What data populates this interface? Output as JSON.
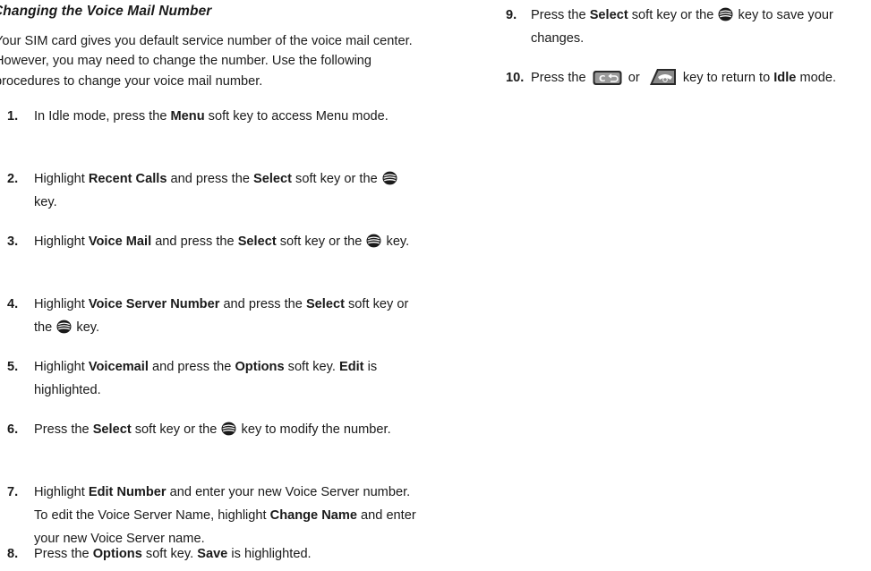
{
  "heading": "Changing the Voice Mail Number",
  "intro": "Your SIM card gives you default service number of the voice mail center. However, you may need to change the number. Use the following procedures to change your voice mail number.",
  "steps": [
    {
      "num": "1.",
      "segments": [
        {
          "t": "In Idle mode, press the "
        },
        {
          "t": "Menu",
          "b": true
        },
        {
          "t": " soft key to access Menu mode."
        }
      ]
    },
    {
      "num": "2.",
      "segments": [
        {
          "t": "Highlight "
        },
        {
          "t": "Recent Calls",
          "b": true
        },
        {
          "t": " and press the "
        },
        {
          "t": "Select",
          "b": true
        },
        {
          "t": " soft key or the "
        },
        {
          "icon": "ok-key-icon"
        },
        {
          "t": " key."
        }
      ]
    },
    {
      "num": "3.",
      "segments": [
        {
          "t": "Highlight "
        },
        {
          "t": "Voice Mail",
          "b": true
        },
        {
          "t": " and press the "
        },
        {
          "t": "Select",
          "b": true
        },
        {
          "t": " soft key or the "
        },
        {
          "icon": "ok-key-icon"
        },
        {
          "t": " key."
        }
      ]
    },
    {
      "num": "4.",
      "segments": [
        {
          "t": "Highlight "
        },
        {
          "t": "Voice Server Number",
          "b": true
        },
        {
          "t": " and press the "
        },
        {
          "t": "Select",
          "b": true
        },
        {
          "t": " soft key or the "
        },
        {
          "icon": "ok-key-icon"
        },
        {
          "t": " key."
        }
      ]
    },
    {
      "num": "5.",
      "segments": [
        {
          "t": "Highlight "
        },
        {
          "t": "Voicemail",
          "b": true
        },
        {
          "t": " and press the "
        },
        {
          "t": "Options",
          "b": true
        },
        {
          "t": " soft key. "
        },
        {
          "t": "Edit",
          "b": true
        },
        {
          "t": " is highlighted."
        }
      ]
    },
    {
      "num": "6.",
      "segments": [
        {
          "t": "Press the "
        },
        {
          "t": "Select",
          "b": true
        },
        {
          "t": " soft key or the "
        },
        {
          "icon": "ok-key-icon"
        },
        {
          "t": " key to modify the number."
        }
      ]
    },
    {
      "num": "7.",
      "segments": [
        {
          "t": "Highlight "
        },
        {
          "t": "Edit Number",
          "b": true
        },
        {
          "t": " and enter your new Voice Server number. To edit the Voice Server Name, highlight "
        },
        {
          "t": "Change Name",
          "b": true
        },
        {
          "t": " and enter your new Voice Server name."
        }
      ]
    },
    {
      "num": "8.",
      "segments": [
        {
          "t": "Press the "
        },
        {
          "t": "Options",
          "b": true
        },
        {
          "t": " soft key. "
        },
        {
          "t": "Save",
          "b": true
        },
        {
          "t": " is highlighted."
        }
      ]
    },
    {
      "num": "9.",
      "segments": [
        {
          "t": "Press the "
        },
        {
          "t": "Select",
          "b": true
        },
        {
          "t": " soft key or the "
        },
        {
          "icon": "ok-key-icon"
        },
        {
          "t": " key to save your changes."
        }
      ]
    },
    {
      "num": "10.",
      "segments": [
        {
          "t": "Press the "
        },
        {
          "icon": "clear-key-icon"
        },
        {
          "t": " or "
        },
        {
          "icon": "end-key-icon"
        },
        {
          "t": " key to return to "
        },
        {
          "t": "Idle",
          "b": true
        },
        {
          "t": " mode."
        }
      ]
    }
  ]
}
